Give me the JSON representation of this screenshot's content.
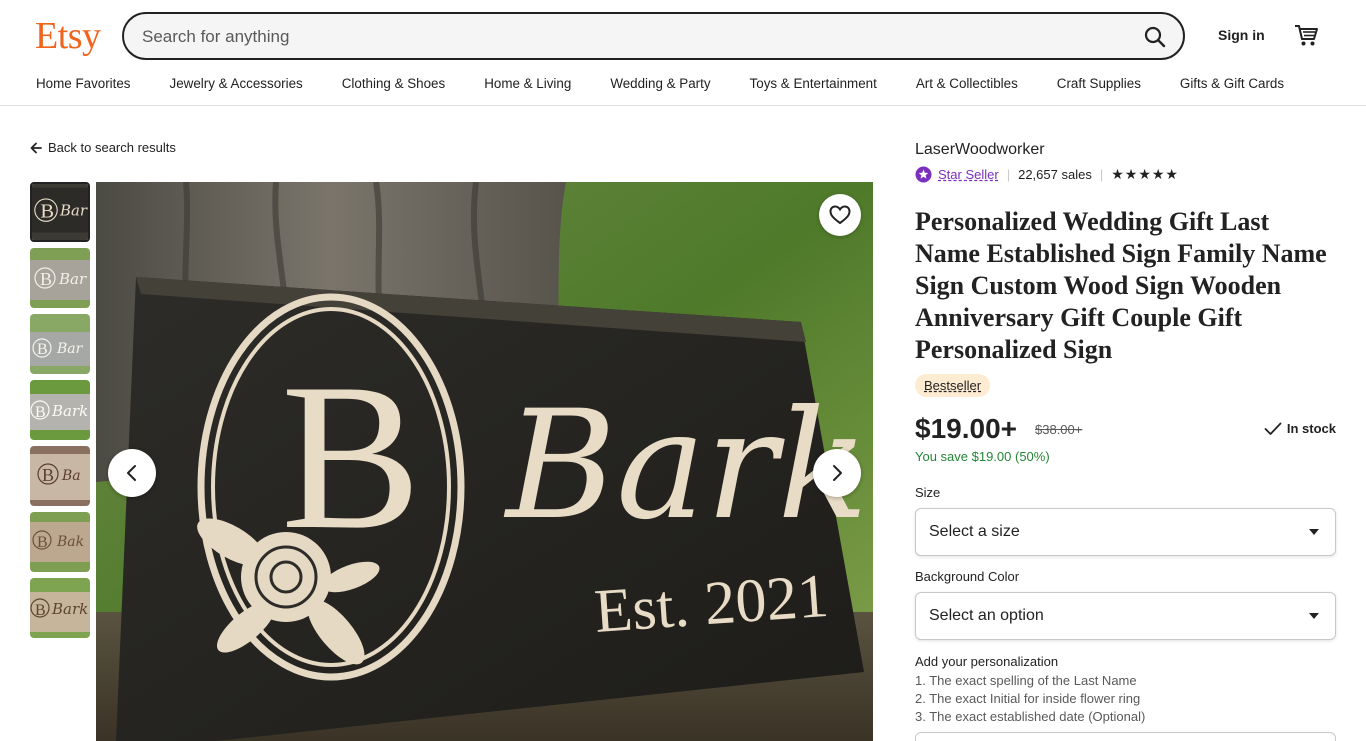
{
  "header": {
    "logo": "Etsy",
    "search_placeholder": "Search for anything",
    "sign_in": "Sign in",
    "brand_color": "#f1641e"
  },
  "nav": {
    "items": [
      "Home Favorites",
      "Jewelry & Accessories",
      "Clothing & Shoes",
      "Home & Living",
      "Wedding & Party",
      "Toys & Entertainment",
      "Art & Collectibles",
      "Craft Supplies",
      "Gifts & Gift Cards"
    ]
  },
  "back_link": "Back to search results",
  "gallery": {
    "thumbnail_count": 7,
    "active_index": 0,
    "image_text": {
      "initial": "B",
      "name": "Barker",
      "established": "Est. 2021"
    }
  },
  "listing": {
    "shop_name": "LaserWoodworker",
    "star_seller": "Star Seller",
    "sales": "22,657 sales",
    "rating_stars": "★★★★★",
    "title": "Personalized Wedding Gift Last Name Established Sign Family Name Sign Custom Wood Sign Wooden Anniversary Gift Couple Gift Personalized Sign",
    "badge": "Bestseller",
    "price": "$19.00+",
    "original_price": "$38.00+",
    "stock": "In stock",
    "savings": "You save $19.00 (50%)",
    "size_label": "Size",
    "size_value": "Select a size",
    "color_label": "Background Color",
    "color_value": "Select an option",
    "personalization_label": "Add your personalization",
    "personalization_lines": [
      "1. The exact spelling of the Last Name",
      "2. The exact Initial for inside flower ring",
      "3. The exact established date (Optional)"
    ]
  }
}
